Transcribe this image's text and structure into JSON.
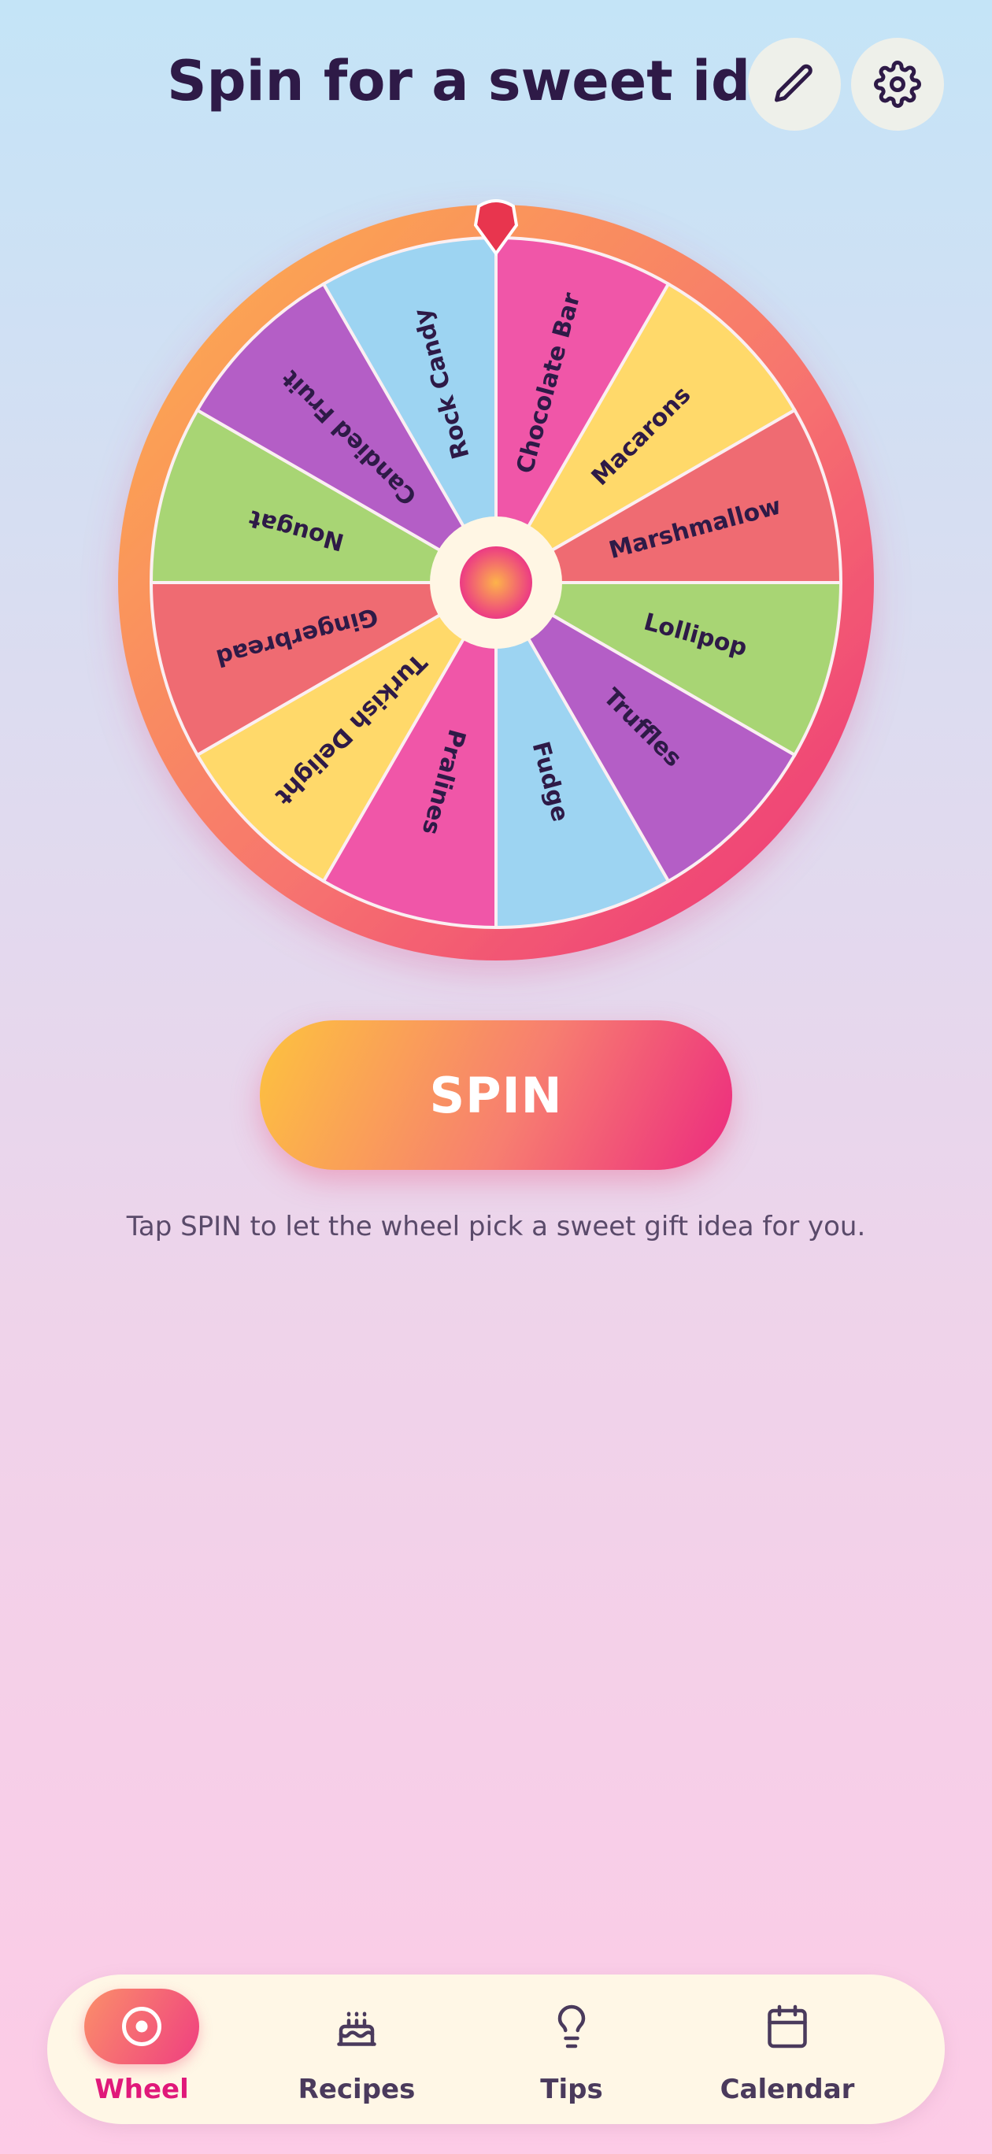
{
  "header": {
    "title": "Spin for a sweet idea",
    "edit_icon": "pencil-icon",
    "settings_icon": "gear-icon"
  },
  "wheel": {
    "pointer_color": "#e8354e",
    "rim_colors": [
      "#fdb24a",
      "#f7766e",
      "#ec2f7a"
    ],
    "segments": [
      {
        "label": "Chocolate Bar",
        "color": "#f056a8"
      },
      {
        "label": "Macarons",
        "color": "#ffd96a"
      },
      {
        "label": "Marshmallow",
        "color": "#ef6b72"
      },
      {
        "label": "Lollipop",
        "color": "#a8d574"
      },
      {
        "label": "Truffles",
        "color": "#b45ec6"
      },
      {
        "label": "Fudge",
        "color": "#9dd4f2"
      },
      {
        "label": "Pralines",
        "color": "#f056a8"
      },
      {
        "label": "Turkish Delight",
        "color": "#ffd96a"
      },
      {
        "label": "Gingerbread",
        "color": "#ef6b72"
      },
      {
        "label": "Nougat",
        "color": "#a8d574"
      },
      {
        "label": "Candied Fruit",
        "color": "#b45ec6"
      },
      {
        "label": "Rock Candy",
        "color": "#9dd4f2"
      }
    ]
  },
  "spin_button": {
    "label": "SPIN"
  },
  "hint": "Tap SPIN to let the wheel pick a sweet gift idea for you.",
  "nav": {
    "items": [
      {
        "label": "Wheel",
        "icon": "wheel-icon",
        "active": true
      },
      {
        "label": "Recipes",
        "icon": "cake-icon",
        "active": false
      },
      {
        "label": "Tips",
        "icon": "lightbulb-icon",
        "active": false
      },
      {
        "label": "Calendar",
        "icon": "calendar-icon",
        "active": false
      }
    ]
  }
}
